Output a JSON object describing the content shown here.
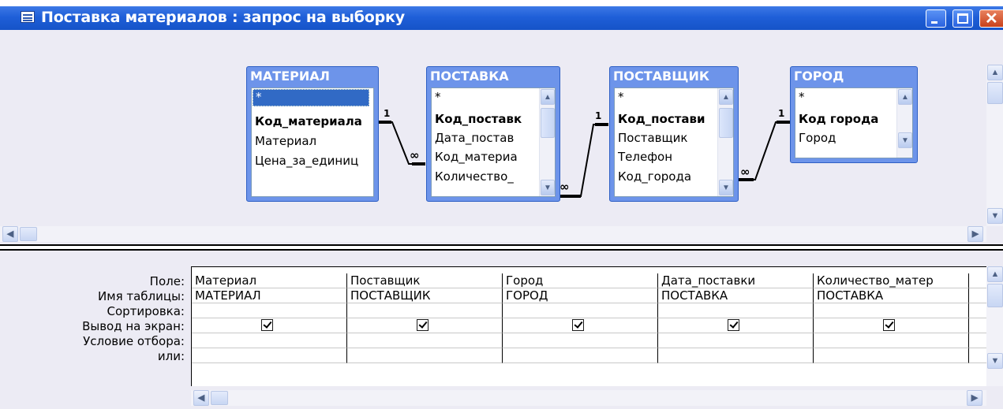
{
  "window": {
    "title": "Поставка материалов : запрос на выборку",
    "icon": "query-icon",
    "buttons": [
      "minimize-icon",
      "maximize-icon",
      "close-icon"
    ]
  },
  "tables": [
    {
      "name": "МАТЕРИАЛ",
      "fields": [
        {
          "label": "*",
          "key": false,
          "selected": true
        },
        {
          "label": "Код_материала",
          "key": true
        },
        {
          "label": "Материал",
          "key": false
        },
        {
          "label": "Цена_за_единиц",
          "key": false
        }
      ]
    },
    {
      "name": "ПОСТАВКА",
      "fields": [
        {
          "label": "*",
          "key": false
        },
        {
          "label": "Код_поставк",
          "key": true
        },
        {
          "label": "Дата_постав",
          "key": false
        },
        {
          "label": "Код_материа",
          "key": false
        },
        {
          "label": "Количество_",
          "key": false
        }
      ]
    },
    {
      "name": "ПОСТАВЩИК",
      "fields": [
        {
          "label": "*",
          "key": false
        },
        {
          "label": "Код_постави",
          "key": true
        },
        {
          "label": "Поставщик",
          "key": false
        },
        {
          "label": "Телефон",
          "key": false
        },
        {
          "label": "Код_города",
          "key": false
        }
      ]
    },
    {
      "name": "ГОРОД",
      "fields": [
        {
          "label": "*",
          "key": false
        },
        {
          "label": "Код города",
          "key": true
        },
        {
          "label": "Город",
          "key": false
        }
      ]
    }
  ],
  "relations": {
    "one": "1",
    "many": "∞"
  },
  "grid": {
    "row_labels": [
      "Поле:",
      "Имя таблицы:",
      "Сортировка:",
      "Вывод на экран:",
      "Условие отбора:",
      "или:"
    ],
    "columns": [
      {
        "field": "Материал",
        "table": "МАТЕРИАЛ",
        "show": true
      },
      {
        "field": "Поставщик",
        "table": "ПОСТАВЩИК",
        "show": true
      },
      {
        "field": "Город",
        "table": "ГОРОД",
        "show": true
      },
      {
        "field": "Дата_поставки",
        "table": "ПОСТАВКА",
        "show": true
      },
      {
        "field": "Количество_матер",
        "table": "ПОСТАВКА",
        "show": true
      }
    ]
  },
  "colors": {
    "titlebar": "#1f5fd8",
    "table_header": "#6d94ea",
    "pane_bg": "#ecebf4"
  }
}
